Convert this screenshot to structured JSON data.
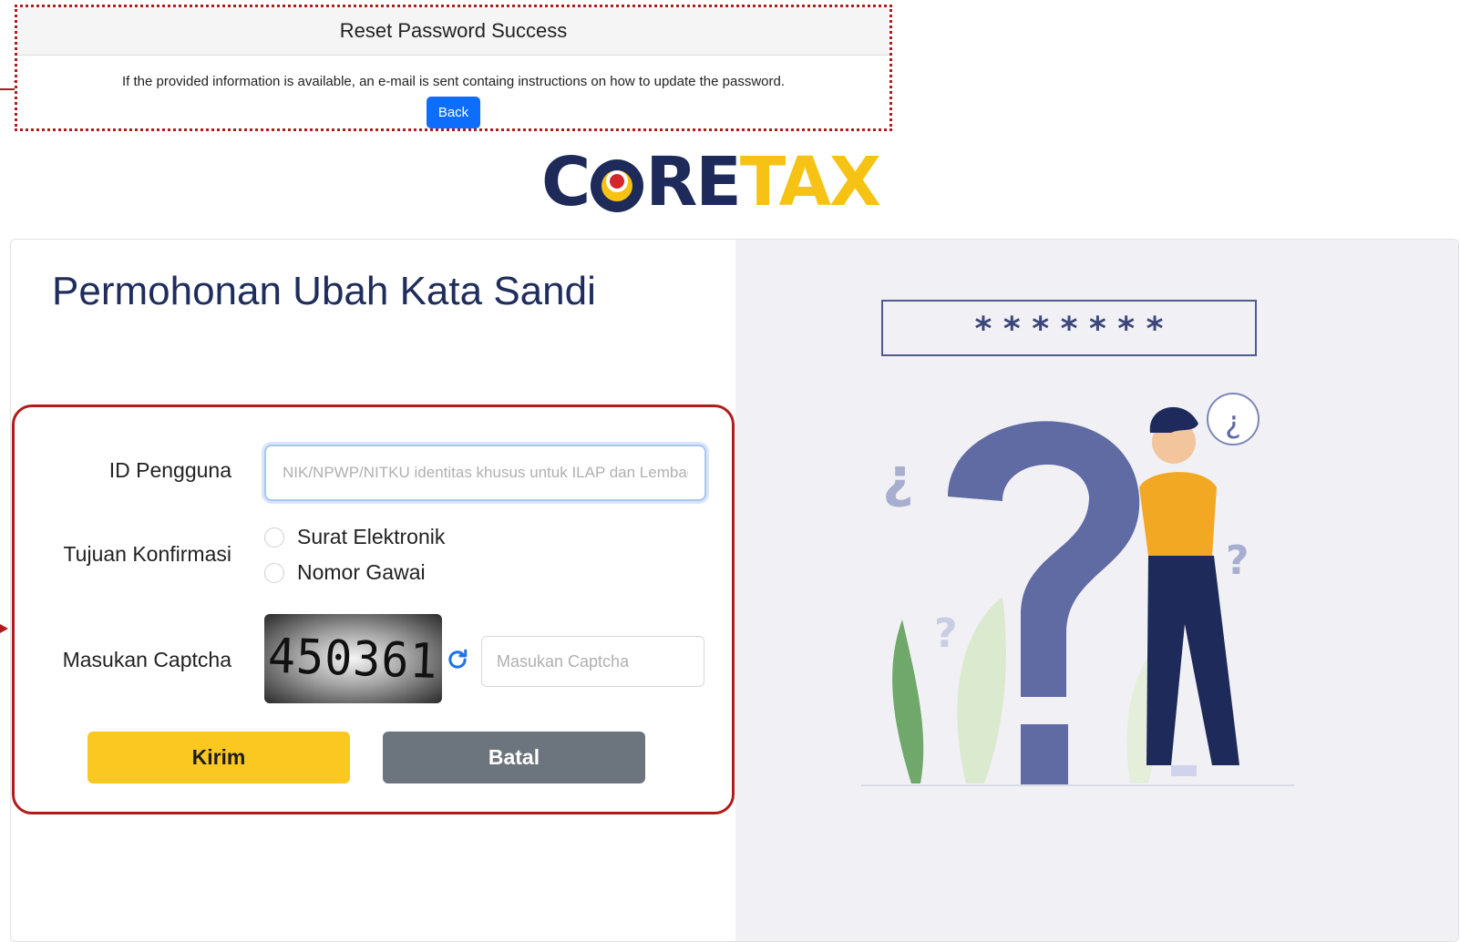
{
  "success_dialog": {
    "title": "Reset Password Success",
    "message": "If the provided information is available, an e-mail is sent containg instructions on how to update the password.",
    "back_label": "Back"
  },
  "logo": {
    "part1": "C",
    "part2": "RE",
    "part3": "TAX"
  },
  "form": {
    "title": "Permohonan Ubah Kata Sandi",
    "id_label": "ID Pengguna",
    "id_placeholder": "NIK/NPWP/NITKU identitas khusus untuk ILAP dan Lembaga",
    "id_value": "",
    "confirm_label": "Tujuan Konfirmasi",
    "confirm_options": [
      "Surat Elektronik",
      "Nomor Gawai"
    ],
    "captcha_label": "Masukan Captcha",
    "captcha_code": "450361",
    "captcha_placeholder": "Masukan Captcha",
    "submit_label": "Kirim",
    "cancel_label": "Batal"
  },
  "illustration": {
    "password_mask": "* * * * * * *"
  },
  "colors": {
    "accent_blue": "#0d6efd",
    "brand_navy": "#1d2a5a",
    "brand_yellow": "#f6c315",
    "annotation_red": "#b01c1c",
    "cancel_gray": "#6c757d"
  }
}
